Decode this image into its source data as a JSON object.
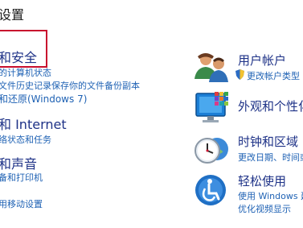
{
  "page": {
    "title": "设置"
  },
  "left_categories": [
    {
      "title": "和安全",
      "links": [
        "的计算机状态",
        "文件历史记录保存你的文件备份副本",
        "和还原(Windows 7)"
      ]
    },
    {
      "title": "和 Internet",
      "links": [
        "络状态和任务"
      ]
    },
    {
      "title": "和声音",
      "links": [
        "备和打印机",
        "用移动设置"
      ]
    }
  ],
  "right_categories": [
    {
      "title": "用户帐户",
      "links": [
        "更改帐户类型"
      ],
      "icon": "user-accounts-icon",
      "link_icon": "shield-icon"
    },
    {
      "title": "外观和个性化",
      "links": [],
      "icon": "appearance-monitor-icon"
    },
    {
      "title": "时钟和区域",
      "links": [
        "更改日期、时间或"
      ],
      "icon": "clock-globe-icon"
    },
    {
      "title": "轻松使用",
      "links": [
        "使用 Windows 建",
        "优化视频显示"
      ],
      "icon": "ease-of-access-icon"
    }
  ],
  "colors": {
    "title_blue": "#1e3287",
    "link_blue": "#1f62b4",
    "highlight_red": "#c8102e"
  }
}
